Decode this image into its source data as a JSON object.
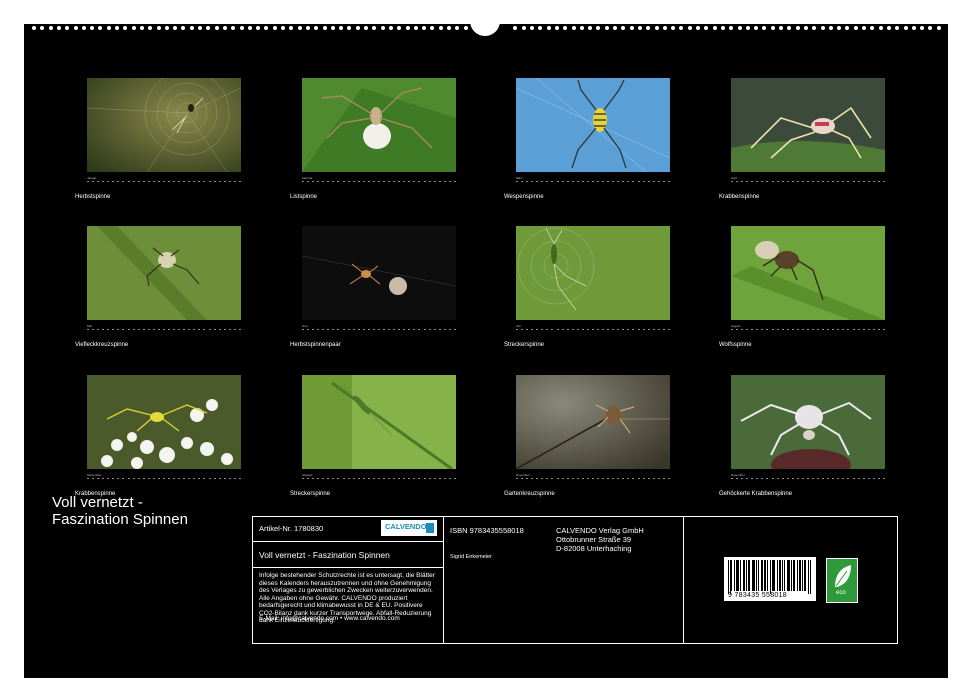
{
  "calendar_title_line1": "Voll vernetzt -",
  "calendar_title_line2": "Faszination Spinnen",
  "months": [
    {
      "name": "Januar",
      "caption": "Herbstspinne"
    },
    {
      "name": "Februar",
      "caption": "Listspinne"
    },
    {
      "name": "März",
      "caption": "Wespenspinne"
    },
    {
      "name": "April",
      "caption": "Krabbenspinne"
    },
    {
      "name": "Mai",
      "caption": "Viefleckkreuzspinne"
    },
    {
      "name": "Juni",
      "caption": "Herbstspinnenpaar"
    },
    {
      "name": "Juli",
      "caption": "Streckerspinne"
    },
    {
      "name": "August",
      "caption": "Wolfsspinne"
    },
    {
      "name": "September",
      "caption": "Krabbenspinne"
    },
    {
      "name": "Oktober",
      "caption": "Streckerspinne"
    },
    {
      "name": "November",
      "caption": "Gartenkreuzspinne"
    },
    {
      "name": "Dezember",
      "caption": "Gehöckerte Krabbenspinne"
    }
  ],
  "info": {
    "article": "Artikel-Nr. 1780830",
    "brand": "CALVENDO",
    "product_title": "Voll vernetzt - Faszination Spinnen",
    "legal_text": "Infolge bestehender Schutzrechte ist es untersagt, die Blätter dieses Kalenders herauszutrennen und ohne Genehmigung des Verlages zu gewerblichen Zwecken weiterzuverwenden. Alle Angaben ohne Gewähr. CALVENDO produziert bedarfsgerecht und klimabewusst in DE & EU. Positivere CO2-Bilanz dank kurzer Transportwege. Abfall-Reduzierung dank Einzelstückfertigung.",
    "contact": "E-Mail: info@calvendo.com • www.calvendo.com",
    "isbn": "ISBN 9783435558018",
    "publisher_name": "CALVENDO Verlag GmbH",
    "publisher_street": "Ottobrunner Straße 39",
    "publisher_city": "D-82008 Unterhaching",
    "author": "Sigrid Enkemeier",
    "barcode_number": "9 783435 558018",
    "eco_label": "eco"
  },
  "colors": {
    "background": "#000000",
    "eco": "#2e9a3a",
    "calvendo": "#1a8fb5"
  }
}
